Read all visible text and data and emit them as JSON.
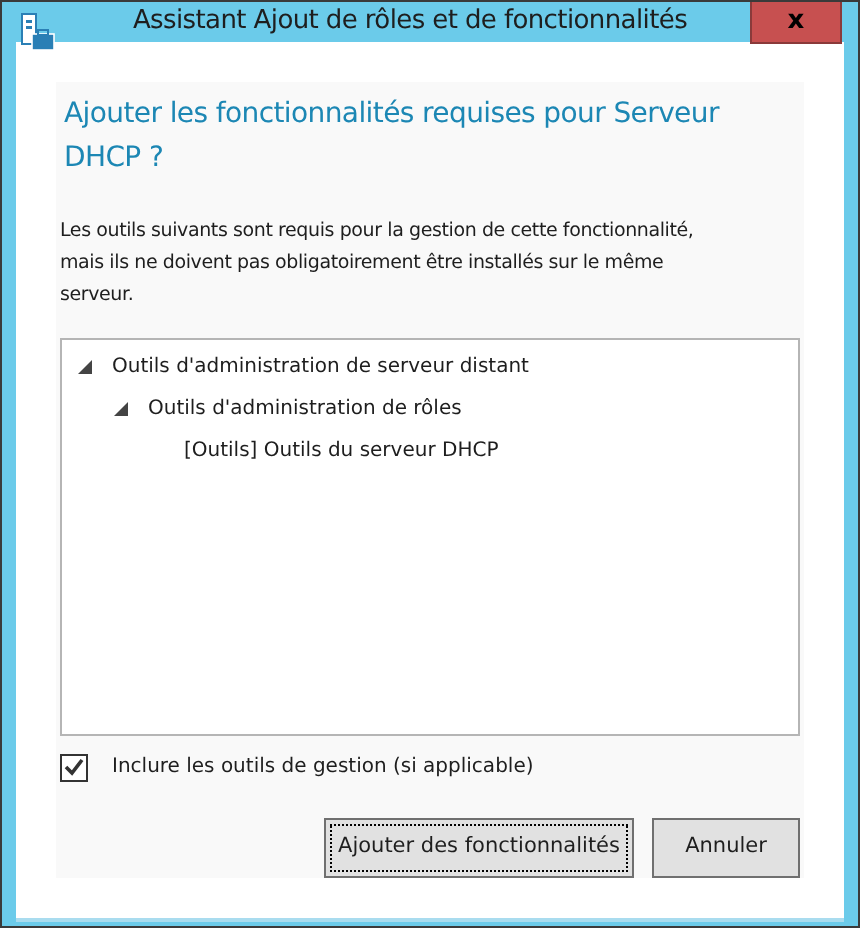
{
  "window": {
    "title": "Assistant Ajout de rôles et de fonctionnalités",
    "close": "x"
  },
  "heading": "Ajouter les fonctionnalités requises pour Serveur DHCP ?",
  "description": "Les outils suivants sont requis pour la gestion de cette fonctionnalité, mais ils ne doivent pas obligatoirement être installés sur le même serveur.",
  "tree": [
    {
      "label": "Outils d'administration de serveur distant",
      "expanded": true,
      "children": [
        {
          "label": "Outils d'administration de rôles",
          "expanded": true,
          "children": [
            {
              "label": "[Outils] Outils du serveur DHCP"
            }
          ]
        }
      ]
    }
  ],
  "include_tools": {
    "label": "Inclure les outils de gestion (si applicable)",
    "checked": true
  },
  "buttons": [
    {
      "label": "Ajouter des fonctionnalités",
      "focused": true
    },
    {
      "label": "Annuler",
      "focused": false
    }
  ]
}
